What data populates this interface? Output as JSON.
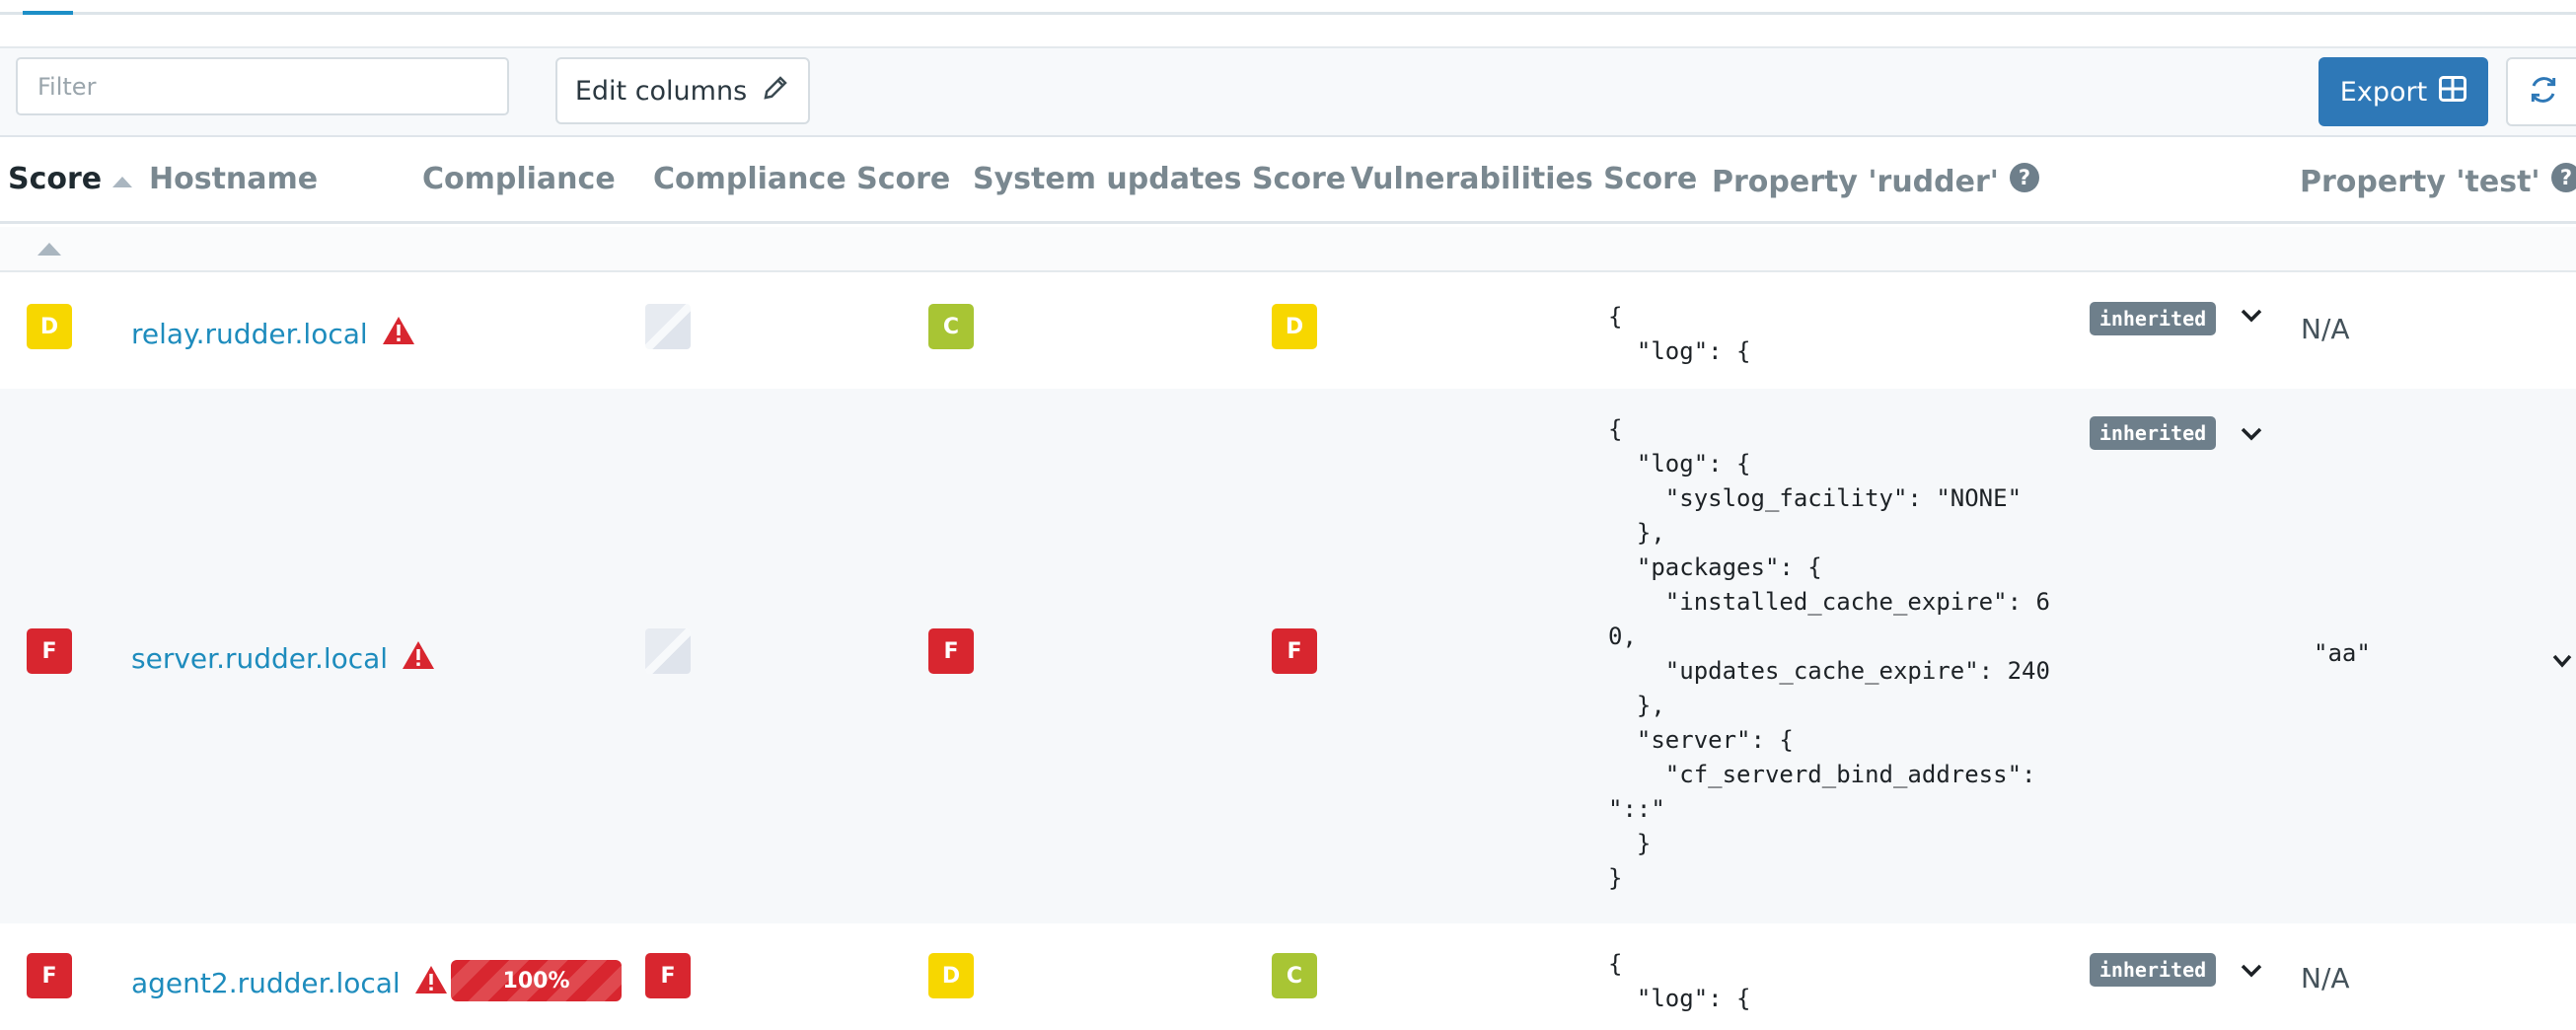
{
  "toolbar": {
    "filter_placeholder": "Filter",
    "filter_value": "",
    "edit_columns_label": "Edit columns",
    "export_label": "Export"
  },
  "columns": [
    {
      "label": "Score",
      "sorted": "asc"
    },
    {
      "label": "Hostname"
    },
    {
      "label": "Compliance"
    },
    {
      "label": "Compliance Score"
    },
    {
      "label": "System updates Score"
    },
    {
      "label": "Vulnerabilities Score"
    },
    {
      "label": "Property 'rudder'",
      "help": true
    },
    {
      "label": "Property 'test'",
      "help": true
    }
  ],
  "colors": {
    "D": "#f7d700",
    "C": "#a8c534",
    "F": "#d8262f",
    "link": "#1e8cbd",
    "accent": "#2e78b7"
  },
  "rows": [
    {
      "score": "D",
      "hostname": "relay.rudder.local",
      "compliance": "",
      "compliance_score": "",
      "system_updates_score": "C",
      "vulnerabilities_score": "D",
      "property_rudder": "{\n  \"log\": {",
      "property_rudder_badge": "inherited",
      "property_test": "N/A"
    },
    {
      "score": "F",
      "hostname": "server.rudder.local",
      "compliance": "",
      "compliance_score": "",
      "system_updates_score": "F",
      "vulnerabilities_score": "F",
      "property_rudder": "{\n  \"log\": {\n    \"syslog_facility\": \"NONE\"\n  },\n  \"packages\": {\n    \"installed_cache_expire\": 6\n0,\n    \"updates_cache_expire\": 240\n  },\n  \"server\": {\n    \"cf_serverd_bind_address\":\n\"::\"\n  }\n}",
      "property_rudder_badge": "inherited",
      "property_test": "\"aa\""
    },
    {
      "score": "F",
      "hostname": "agent2.rudder.local",
      "compliance": "100%",
      "compliance_value": 100,
      "compliance_score": "F",
      "system_updates_score": "D",
      "vulnerabilities_score": "C",
      "property_rudder": "{\n  \"log\": {",
      "property_rudder_badge": "inherited",
      "property_test": "N/A"
    }
  ]
}
